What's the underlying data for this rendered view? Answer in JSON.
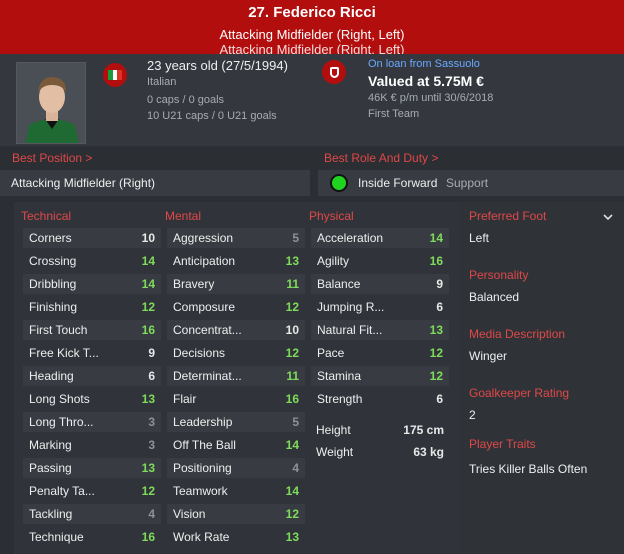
{
  "header": {
    "title": "27. Federico Ricci",
    "position": "Attacking Midfielder (Right, Left)",
    "position_repeat": "Attacking Midfielder (Right, Left)"
  },
  "info": {
    "age": "23 years old (27/5/1994)",
    "nationality": "Italian",
    "caps": "0 caps / 0 goals",
    "u21": "10 U21 caps / 0 U21 goals",
    "loan_from": "On loan from Sassuolo",
    "value": "Valued at 5.75M €",
    "wage": "46K € p/m until 30/6/2018",
    "squad": "First Team"
  },
  "best_position": {
    "heading": "Best Position >",
    "value": "Attacking Midfielder (Right)"
  },
  "best_role": {
    "heading": "Best Role And Duty >",
    "role": "Inside Forward",
    "duty": "Support"
  },
  "technical": {
    "heading": "Technical",
    "rows": [
      {
        "label": "Corners",
        "value": "10",
        "tone": "white"
      },
      {
        "label": "Crossing",
        "value": "14",
        "tone": "green"
      },
      {
        "label": "Dribbling",
        "value": "14",
        "tone": "green"
      },
      {
        "label": "Finishing",
        "value": "12",
        "tone": "green"
      },
      {
        "label": "First Touch",
        "value": "16",
        "tone": "green"
      },
      {
        "label": "Free Kick T...",
        "value": "9",
        "tone": "white"
      },
      {
        "label": "Heading",
        "value": "6",
        "tone": "white"
      },
      {
        "label": "Long Shots",
        "value": "13",
        "tone": "green"
      },
      {
        "label": "Long Thro...",
        "value": "3",
        "tone": "grey"
      },
      {
        "label": "Marking",
        "value": "3",
        "tone": "grey"
      },
      {
        "label": "Passing",
        "value": "13",
        "tone": "green"
      },
      {
        "label": "Penalty Ta...",
        "value": "12",
        "tone": "green"
      },
      {
        "label": "Tackling",
        "value": "4",
        "tone": "grey"
      },
      {
        "label": "Technique",
        "value": "16",
        "tone": "green"
      }
    ]
  },
  "mental": {
    "heading": "Mental",
    "rows": [
      {
        "label": "Aggression",
        "value": "5",
        "tone": "grey"
      },
      {
        "label": "Anticipation",
        "value": "13",
        "tone": "green"
      },
      {
        "label": "Bravery",
        "value": "11",
        "tone": "green"
      },
      {
        "label": "Composure",
        "value": "12",
        "tone": "green"
      },
      {
        "label": "Concentrat...",
        "value": "10",
        "tone": "white"
      },
      {
        "label": "Decisions",
        "value": "12",
        "tone": "green"
      },
      {
        "label": "Determinat...",
        "value": "11",
        "tone": "green"
      },
      {
        "label": "Flair",
        "value": "16",
        "tone": "green"
      },
      {
        "label": "Leadership",
        "value": "5",
        "tone": "grey"
      },
      {
        "label": "Off The Ball",
        "value": "14",
        "tone": "green"
      },
      {
        "label": "Positioning",
        "value": "4",
        "tone": "grey"
      },
      {
        "label": "Teamwork",
        "value": "14",
        "tone": "green"
      },
      {
        "label": "Vision",
        "value": "12",
        "tone": "green"
      },
      {
        "label": "Work Rate",
        "value": "13",
        "tone": "green"
      }
    ]
  },
  "physical": {
    "heading": "Physical",
    "rows": [
      {
        "label": "Acceleration",
        "value": "14",
        "tone": "green"
      },
      {
        "label": "Agility",
        "value": "16",
        "tone": "green"
      },
      {
        "label": "Balance",
        "value": "9",
        "tone": "white"
      },
      {
        "label": "Jumping R...",
        "value": "6",
        "tone": "white"
      },
      {
        "label": "Natural Fit...",
        "value": "13",
        "tone": "green"
      },
      {
        "label": "Pace",
        "value": "12",
        "tone": "green"
      },
      {
        "label": "Stamina",
        "value": "12",
        "tone": "green"
      },
      {
        "label": "Strength",
        "value": "6",
        "tone": "white"
      }
    ],
    "height_label": "Height",
    "height_value": "175 cm",
    "weight_label": "Weight",
    "weight_value": "63 kg"
  },
  "side": {
    "foot_heading": "Preferred Foot",
    "foot": "Left",
    "personality_heading": "Personality",
    "personality": "Balanced",
    "media_heading": "Media Description",
    "media": "Winger",
    "gk_heading": "Goalkeeper Rating",
    "gk": "2",
    "traits_heading": "Player Traits",
    "traits": "Tries Killer Balls Often"
  },
  "colors": {
    "header": "#b20e0e",
    "accent_red": "#e04848",
    "attr_green": "#7fdc5a",
    "loan_blue": "#6aa9ff",
    "role_dot": "#1fd31f"
  },
  "icons": [
    "italy-flag-icon",
    "club-crest-icon",
    "trend-arrow-icon",
    "chevron-down-icon",
    "player-photo"
  ]
}
